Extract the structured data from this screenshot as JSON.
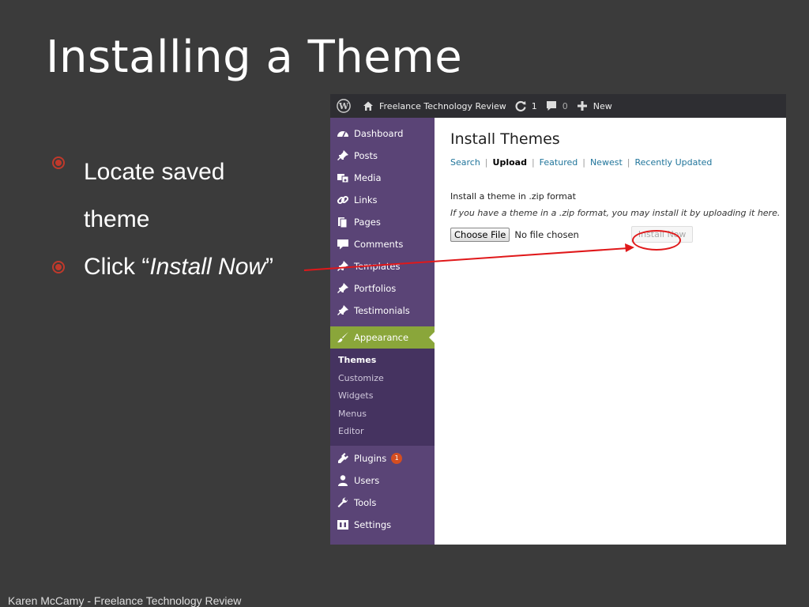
{
  "slide": {
    "title": "Installing a Theme",
    "bullets": [
      {
        "lines": [
          "Locate saved",
          "theme"
        ]
      },
      {
        "prefix": "Click “",
        "emphasis": "Install Now",
        "suffix": "”"
      }
    ],
    "footer": "Karen McCamy - Freelance Technology Review",
    "colors": {
      "background": "#3b3b3b",
      "bullet": "#c0392b",
      "callout": "#e0181a"
    }
  },
  "adminbar": {
    "site_name": "Freelance Technology Review",
    "updates_count": "1",
    "comments_count": "0",
    "new_label": "New"
  },
  "sidebar": {
    "items_top": [
      {
        "label": "Dashboard",
        "icon": "dashboard-icon"
      },
      {
        "label": "Posts",
        "icon": "pin-icon"
      },
      {
        "label": "Media",
        "icon": "media-icon"
      },
      {
        "label": "Links",
        "icon": "link-icon"
      },
      {
        "label": "Pages",
        "icon": "pages-icon"
      },
      {
        "label": "Comments",
        "icon": "comment-icon"
      },
      {
        "label": "Templates",
        "icon": "pin-icon"
      },
      {
        "label": "Portfolios",
        "icon": "pin-icon"
      },
      {
        "label": "Testimonials",
        "icon": "pin-icon"
      }
    ],
    "active_label": "Appearance",
    "submenu": [
      "Themes",
      "Customize",
      "Widgets",
      "Menus",
      "Editor"
    ],
    "items_bottom": [
      {
        "label": "Plugins",
        "icon": "plugin-icon",
        "badge": "1"
      },
      {
        "label": "Users",
        "icon": "user-icon"
      },
      {
        "label": "Tools",
        "icon": "wrench-icon"
      },
      {
        "label": "Settings",
        "icon": "settings-icon"
      }
    ]
  },
  "content": {
    "heading": "Install Themes",
    "tabs": {
      "search": "Search",
      "upload": "Upload",
      "featured": "Featured",
      "newest": "Newest",
      "recently_updated": "Recently Updated"
    },
    "zip_title": "Install a theme in .zip format",
    "zip_desc": "If you have a theme in a .zip format, you may install it by uploading it here.",
    "choose_file": "Choose File",
    "no_file": "No file chosen",
    "install_now": "Install Now"
  }
}
